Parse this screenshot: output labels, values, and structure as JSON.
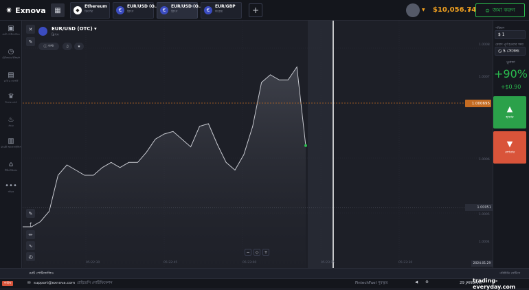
{
  "brand": {
    "name": "Exnova"
  },
  "tabs": [
    {
      "title": "Ethereum",
      "sub": "ক্রিপ্টো"
    },
    {
      "title": "EUR/USD (O...",
      "sub": "ব্লিৎস"
    },
    {
      "title": "EUR/USD (O...",
      "sub": "ব্লিৎস"
    },
    {
      "title": "EUR/GBP",
      "sub": "ফরেক্স"
    }
  ],
  "header": {
    "balance": "$10,056.74",
    "deposit_label": "জমা করুন"
  },
  "nav": [
    {
      "label": "মোট পোর্টফোলিও"
    },
    {
      "label": "ট্রেডিংয়ের ইতিহাস"
    },
    {
      "label": "চ্যাট ও সাপোর্ট"
    },
    {
      "label": "লিডার বোর্ড"
    },
    {
      "label": "প্রচার"
    },
    {
      "label": "মার্কেট অ্যানালাইসিস"
    },
    {
      "label": "টিউটোরিয়াল"
    },
    {
      "label": "আরও"
    }
  ],
  "asset": {
    "title": "EUR/USD (OTC)",
    "sub": "ব্লিৎস",
    "info_label": "তথ্য"
  },
  "trade_panel": {
    "amount_label": "পরিমাণ",
    "amount_value": "1",
    "expiry_label": "মেয়াদ পূর্ণ হওয়ার সময়",
    "expiry_value": "5 সেকেন্ড",
    "payout_label": "মুনাফা",
    "payout_pct": "+90%",
    "payout_amount": "+$0.90",
    "higher_label": "হায়ার",
    "lower_label": "লোয়ার"
  },
  "chart_data": {
    "type": "area",
    "current_price": "1.000695",
    "strike_price": "1.00051",
    "y_axis_labels": [
      "1.0008",
      "1.0007",
      "1.0006",
      "1.0005",
      "1.0004"
    ],
    "time_labels": [
      "05:22:30",
      "05:22:45",
      "05:23:00",
      "05:23:15",
      "05:23:30"
    ],
    "date_label": "2024.01.29",
    "values": [
      1.00038,
      1.00038,
      1.0004,
      1.00044,
      1.00058,
      1.00062,
      1.0006,
      1.00058,
      1.00058,
      1.00061,
      1.00063,
      1.00061,
      1.00063,
      1.00063,
      1.00067,
      1.00072,
      1.00074,
      1.00075,
      1.00072,
      1.00069,
      1.00077,
      1.00078,
      1.0007,
      1.00063,
      1.0006,
      1.00066,
      1.00077,
      1.00094,
      1.00097,
      1.00095,
      1.00095,
      1.001,
      1.000695
    ]
  },
  "bottom": {
    "portfolio_label": "মোট পোর্টফোলিও",
    "settings_label": "পরিচিতি সেটিংস"
  },
  "footer": {
    "support_email": "support@exnova.com",
    "live_label": "লাইভ",
    "policy_text": "প্রাইভেসি নোটিফিকেশন",
    "fintech": "FintechFuel পুরস্কৃত",
    "server_time": "29 JANUARY",
    "watermark": "trading-everyday.com"
  },
  "colors": {
    "accent": "#f0a020",
    "green": "#2bbd4f",
    "red": "#d9543a"
  }
}
